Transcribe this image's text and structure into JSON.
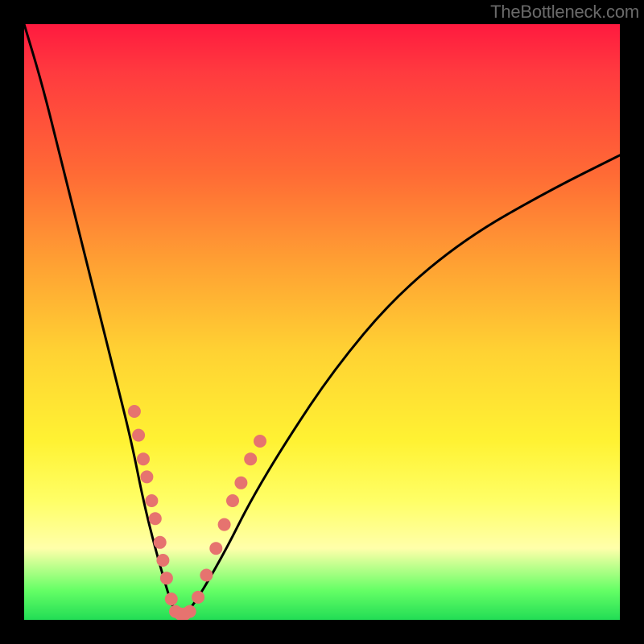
{
  "attribution": "TheBottleneck.com",
  "chart_data": {
    "type": "line",
    "title": "",
    "xlabel": "",
    "ylabel": "",
    "xlim": [
      0,
      100
    ],
    "ylim": [
      0,
      100
    ],
    "grid": false,
    "series": [
      {
        "name": "bottleneck-curve",
        "x": [
          0,
          3,
          6,
          9,
          12,
          15,
          18,
          20,
          22,
          24,
          25,
          26,
          27,
          28,
          30,
          34,
          38,
          44,
          52,
          62,
          74,
          88,
          100
        ],
        "y": [
          100,
          90,
          78,
          66,
          54,
          42,
          30,
          20,
          12,
          5,
          2,
          1,
          1,
          2,
          5,
          12,
          20,
          30,
          42,
          54,
          64,
          72,
          78
        ]
      }
    ],
    "scatter": {
      "name": "marker-dots",
      "color": "#e6736f",
      "points": [
        {
          "x": 18.5,
          "y": 35
        },
        {
          "x": 19.2,
          "y": 31
        },
        {
          "x": 20.0,
          "y": 27
        },
        {
          "x": 20.6,
          "y": 24
        },
        {
          "x": 21.4,
          "y": 20
        },
        {
          "x": 22.0,
          "y": 17
        },
        {
          "x": 22.8,
          "y": 13
        },
        {
          "x": 23.3,
          "y": 10
        },
        {
          "x": 23.9,
          "y": 7
        },
        {
          "x": 24.7,
          "y": 3.5
        },
        {
          "x": 25.4,
          "y": 1.4
        },
        {
          "x": 26.2,
          "y": 1.0
        },
        {
          "x": 27.0,
          "y": 1.0
        },
        {
          "x": 27.8,
          "y": 1.4
        },
        {
          "x": 29.2,
          "y": 3.8
        },
        {
          "x": 30.6,
          "y": 7.5
        },
        {
          "x": 32.2,
          "y": 12
        },
        {
          "x": 33.6,
          "y": 16
        },
        {
          "x": 35.0,
          "y": 20
        },
        {
          "x": 36.4,
          "y": 23
        },
        {
          "x": 38.0,
          "y": 27
        },
        {
          "x": 39.6,
          "y": 30
        }
      ]
    },
    "curve_min_x": 26.4
  }
}
